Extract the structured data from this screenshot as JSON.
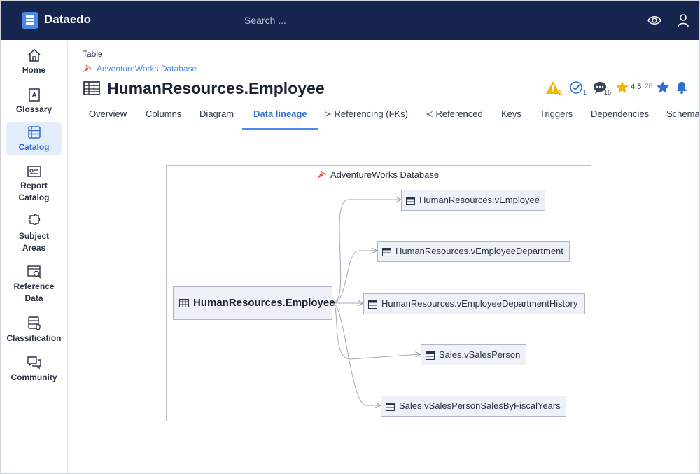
{
  "app": {
    "name": "Dataedo",
    "search_placeholder": "Search ..."
  },
  "sidebar": {
    "items": [
      {
        "label": "Home",
        "icon": "home-icon"
      },
      {
        "label": "Glossary",
        "icon": "glossary-icon"
      },
      {
        "label": "Catalog",
        "icon": "catalog-icon",
        "active": true
      },
      {
        "label": "Report Catalog",
        "icon": "report-catalog-icon"
      },
      {
        "label": "Subject Areas",
        "icon": "subject-areas-icon"
      },
      {
        "label": "Reference Data",
        "icon": "reference-data-icon"
      },
      {
        "label": "Classification",
        "icon": "classification-icon"
      },
      {
        "label": "Community",
        "icon": "community-icon"
      }
    ]
  },
  "header": {
    "object_type": "Table",
    "database": "AdventureWorks Database",
    "title": "HumanResources.Employee",
    "warnings_count": "2",
    "checks_count": "1",
    "comments_count": "16",
    "rating": "4.5",
    "rating_count": "26"
  },
  "tabs": [
    {
      "label": "Overview"
    },
    {
      "label": "Columns"
    },
    {
      "label": "Diagram"
    },
    {
      "label": "Data lineage",
      "active": true
    },
    {
      "label": "Referencing (FKs)"
    },
    {
      "label": "Referenced"
    },
    {
      "label": "Keys"
    },
    {
      "label": "Triggers"
    },
    {
      "label": "Dependencies"
    },
    {
      "label": "Schema"
    }
  ],
  "lineage": {
    "container_label": "AdventureWorks Database",
    "source": "HumanResources.Employee",
    "targets": [
      "HumanResources.vEmployee",
      "HumanResources.vEmployeeDepartment",
      "HumanResources.vEmployeeDepartmentHistory",
      "Sales.vSalesPerson",
      "Sales.vSalesPersonSalesByFiscalYears"
    ]
  },
  "colors": {
    "topbar": "#15254d",
    "accent": "#4a89e8",
    "warning": "#f5b400",
    "star": "#f5b400"
  }
}
